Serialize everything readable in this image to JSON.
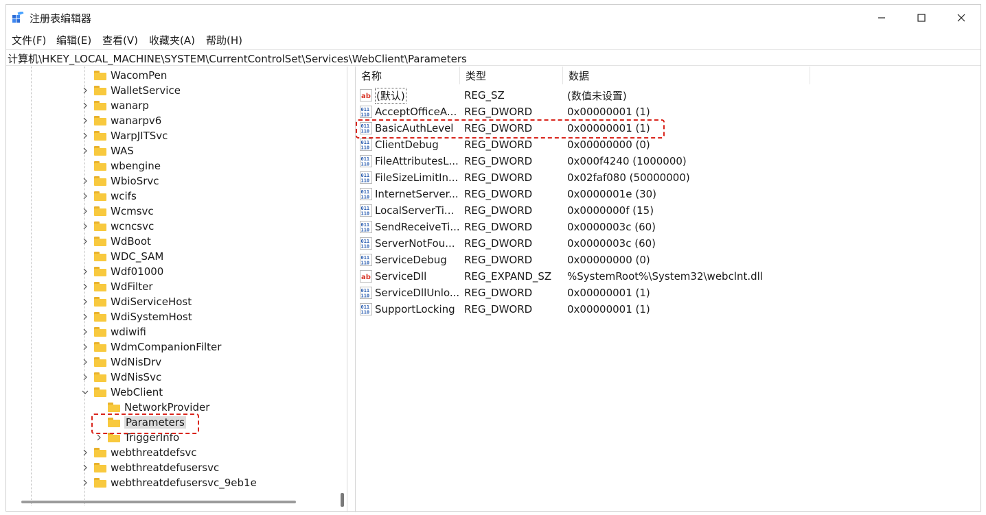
{
  "window": {
    "title": "注册表编辑器",
    "minimize_glyph": "—",
    "maximize_glyph": "☐",
    "close_glyph": "✕"
  },
  "menu": [
    "文件(F)",
    "编辑(E)",
    "查看(V)",
    "收藏夹(A)",
    "帮助(H)"
  ],
  "address": "计算机\\HKEY_LOCAL_MACHINE\\SYSTEM\\CurrentControlSet\\Services\\WebClient\\Parameters",
  "tree": [
    {
      "label": "WacomPen",
      "expander": "",
      "level": 0
    },
    {
      "label": "WalletService",
      "expander": ">",
      "level": 0
    },
    {
      "label": "wanarp",
      "expander": ">",
      "level": 0
    },
    {
      "label": "wanarpv6",
      "expander": ">",
      "level": 0
    },
    {
      "label": "WarpJITSvc",
      "expander": ">",
      "level": 0
    },
    {
      "label": "WAS",
      "expander": ">",
      "level": 0
    },
    {
      "label": "wbengine",
      "expander": "",
      "level": 0
    },
    {
      "label": "WbioSrvc",
      "expander": ">",
      "level": 0
    },
    {
      "label": "wcifs",
      "expander": ">",
      "level": 0
    },
    {
      "label": "Wcmsvc",
      "expander": ">",
      "level": 0
    },
    {
      "label": "wcncsvc",
      "expander": ">",
      "level": 0
    },
    {
      "label": "WdBoot",
      "expander": ">",
      "level": 0
    },
    {
      "label": "WDC_SAM",
      "expander": "",
      "level": 0
    },
    {
      "label": "Wdf01000",
      "expander": ">",
      "level": 0
    },
    {
      "label": "WdFilter",
      "expander": ">",
      "level": 0
    },
    {
      "label": "WdiServiceHost",
      "expander": ">",
      "level": 0
    },
    {
      "label": "WdiSystemHost",
      "expander": ">",
      "level": 0
    },
    {
      "label": "wdiwifi",
      "expander": ">",
      "level": 0
    },
    {
      "label": "WdmCompanionFilter",
      "expander": ">",
      "level": 0
    },
    {
      "label": "WdNisDrv",
      "expander": ">",
      "level": 0
    },
    {
      "label": "WdNisSvc",
      "expander": ">",
      "level": 0
    },
    {
      "label": "WebClient",
      "expander": "v",
      "level": 0
    },
    {
      "label": "NetworkProvider",
      "expander": "",
      "level": 1
    },
    {
      "label": "Parameters",
      "expander": "",
      "level": 1,
      "selected": true
    },
    {
      "label": "TriggerInfo",
      "expander": ">",
      "level": 1
    },
    {
      "label": "webthreatdefsvc",
      "expander": ">",
      "level": 0
    },
    {
      "label": "webthreatdefusersvc",
      "expander": ">",
      "level": 0
    },
    {
      "label": "webthreatdefusersvc_9eb1e",
      "expander": ">",
      "level": 0
    }
  ],
  "list": {
    "columns": [
      "名称",
      "类型",
      "数据"
    ],
    "rows": [
      {
        "name": "(默认)",
        "type": "REG_SZ",
        "data": "(数值未设置)",
        "icon": "string-value-icon"
      },
      {
        "name": "AcceptOfficeA...",
        "type": "REG_DWORD",
        "data": "0x00000001 (1)",
        "icon": "binary-value-icon"
      },
      {
        "name": "BasicAuthLevel",
        "type": "REG_DWORD",
        "data": "0x00000001 (1)",
        "icon": "binary-value-icon",
        "highlighted": true
      },
      {
        "name": "ClientDebug",
        "type": "REG_DWORD",
        "data": "0x00000000 (0)",
        "icon": "binary-value-icon"
      },
      {
        "name": "FileAttributesL...",
        "type": "REG_DWORD",
        "data": "0x000f4240 (1000000)",
        "icon": "binary-value-icon"
      },
      {
        "name": "FileSizeLimitIn...",
        "type": "REG_DWORD",
        "data": "0x02faf080 (50000000)",
        "icon": "binary-value-icon"
      },
      {
        "name": "InternetServer...",
        "type": "REG_DWORD",
        "data": "0x0000001e (30)",
        "icon": "binary-value-icon"
      },
      {
        "name": "LocalServerTi...",
        "type": "REG_DWORD",
        "data": "0x0000000f (15)",
        "icon": "binary-value-icon"
      },
      {
        "name": "SendReceiveTi...",
        "type": "REG_DWORD",
        "data": "0x0000003c (60)",
        "icon": "binary-value-icon"
      },
      {
        "name": "ServerNotFou...",
        "type": "REG_DWORD",
        "data": "0x0000003c (60)",
        "icon": "binary-value-icon"
      },
      {
        "name": "ServiceDebug",
        "type": "REG_DWORD",
        "data": "0x00000000 (0)",
        "icon": "binary-value-icon"
      },
      {
        "name": "ServiceDll",
        "type": "REG_EXPAND_SZ",
        "data": "%SystemRoot%\\System32\\webclnt.dll",
        "icon": "string-value-icon"
      },
      {
        "name": "ServiceDllUnlo...",
        "type": "REG_DWORD",
        "data": "0x00000001 (1)",
        "icon": "binary-value-icon"
      },
      {
        "name": "SupportLocking",
        "type": "REG_DWORD",
        "data": "0x00000001 (1)",
        "icon": "binary-value-icon"
      }
    ]
  },
  "colors": {
    "highlight_dash": "#d9251c",
    "folder": "#f8c93e"
  }
}
